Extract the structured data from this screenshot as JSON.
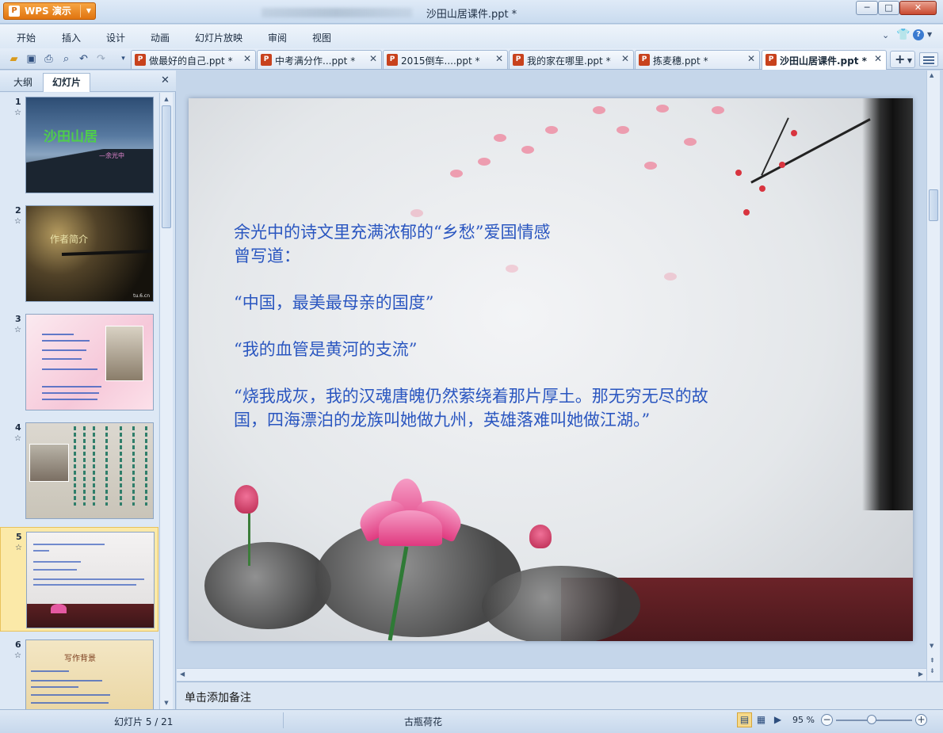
{
  "app": {
    "menu_button": "WPS 演示",
    "window_title": "沙田山居课件.ppt *"
  },
  "window_controls": {
    "minimize": "─",
    "maximize": "□",
    "close": "✕"
  },
  "menu": {
    "items": [
      "开始",
      "插入",
      "设计",
      "动画",
      "幻灯片放映",
      "审阅",
      "视图"
    ],
    "right": {
      "collapse": "⌄",
      "skin": "👕",
      "help": "?"
    }
  },
  "toolbar": {
    "icons": [
      "open-folder-icon",
      "save-icon",
      "print-icon",
      "print-preview-icon",
      "undo-icon",
      "redo-icon",
      "customize-dropdown-icon"
    ]
  },
  "doc_tabs": [
    {
      "label": "做最好的自己.ppt *",
      "active": false
    },
    {
      "label": "中考满分作...ppt *",
      "active": false
    },
    {
      "label": "2015倒车....ppt *",
      "active": false
    },
    {
      "label": "我的家在哪里.ppt *",
      "active": false
    },
    {
      "label": "拣麦穗.ppt *",
      "active": false
    },
    {
      "label": "沙田山居课件.ppt *",
      "active": true
    }
  ],
  "left_panel": {
    "tabs": [
      "大纲",
      "幻灯片"
    ],
    "active_tab": "幻灯片",
    "thumbnails": [
      {
        "number": "1",
        "star": "☆",
        "title": "沙田山居",
        "subtitle": "—余光中"
      },
      {
        "number": "2",
        "star": "☆",
        "title": "作者简介",
        "footer": "tu.6.cn"
      },
      {
        "number": "3",
        "star": "☆"
      },
      {
        "number": "4",
        "star": "☆"
      },
      {
        "number": "5",
        "star": "☆",
        "selected": true
      },
      {
        "number": "6",
        "star": "☆",
        "title": "写作背景"
      }
    ]
  },
  "slide": {
    "paragraphs": [
      "余光中的诗文里充满浓郁的“乡愁”爱国情感",
      "曾写道：",
      "",
      "“中国，最美最母亲的国度”",
      "",
      "“我的血管是黄河的支流”",
      "",
      "“烧我成灰，我的汉魂唐魄仍然萦绕着那片厚土。那无穷无尽的故",
      "国，四海漂泊的龙族叫她做九州，英雄落难叫她做江湖。”"
    ]
  },
  "notes": {
    "placeholder": "单击添加备注"
  },
  "status": {
    "slide_position": "幻灯片 5 / 21",
    "theme": "古瓶荷花",
    "zoom": "95 %",
    "zoom_value": 95
  },
  "colors": {
    "accent_orange": "#e0740f",
    "slide_text": "#2a56c0",
    "selected_thumb": "#fbe9a8"
  }
}
